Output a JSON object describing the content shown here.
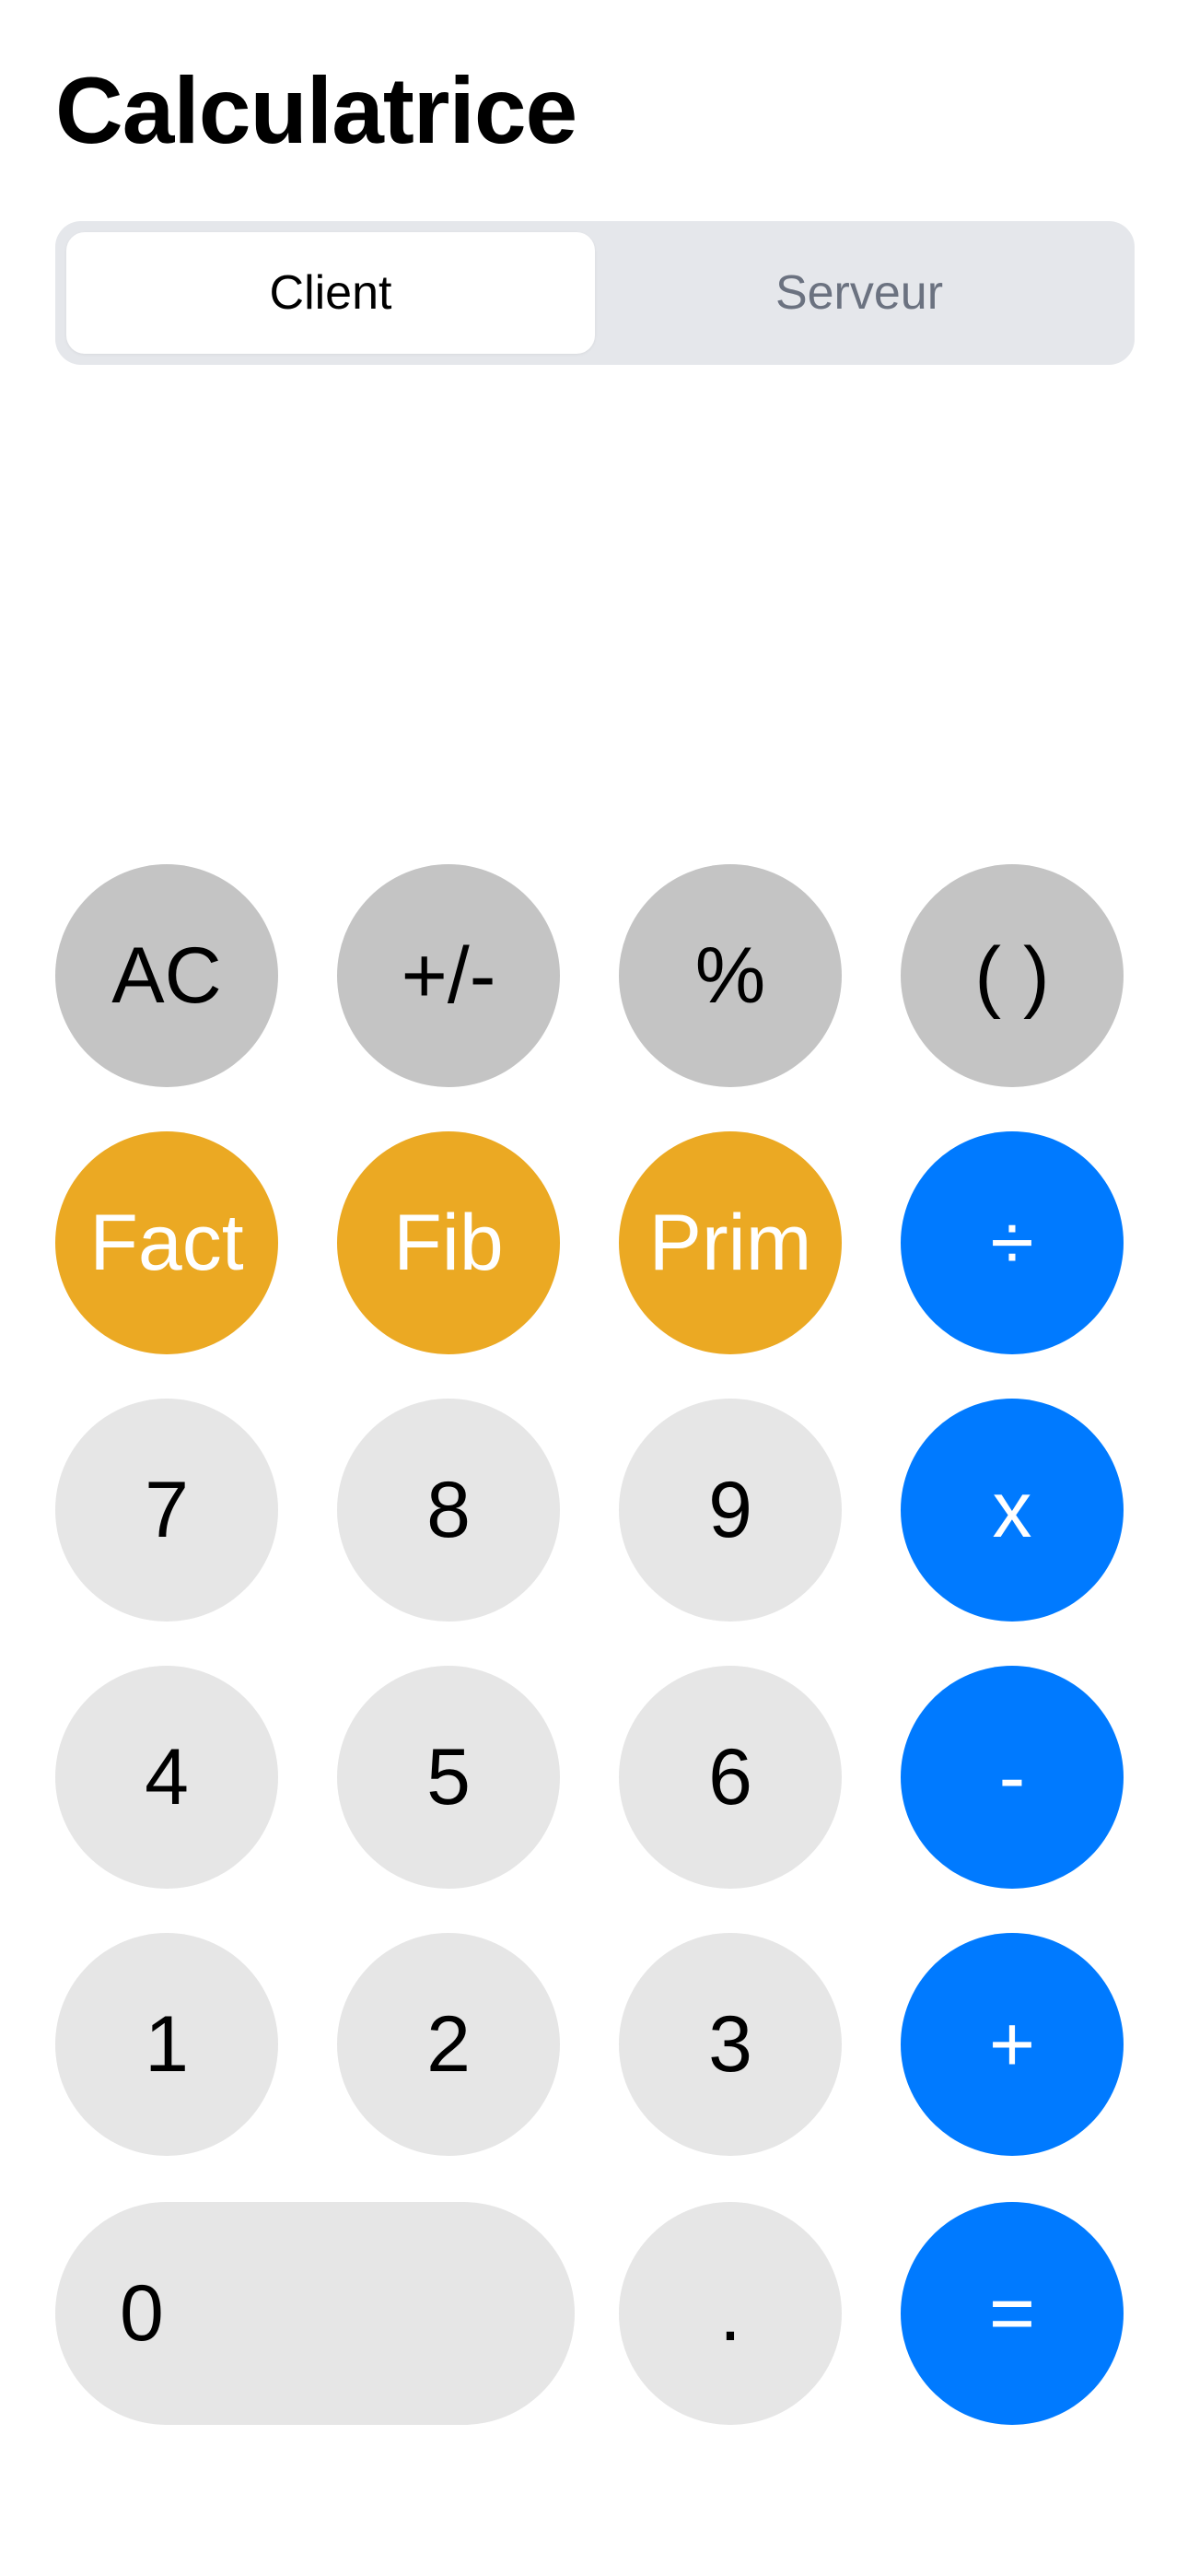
{
  "app": {
    "title": "Calculatrice"
  },
  "mode_switch": {
    "options": [
      {
        "label": "Client",
        "selected": true
      },
      {
        "label": "Serveur",
        "selected": false
      }
    ]
  },
  "display": {
    "value": ""
  },
  "keypad": {
    "row1": [
      "AC",
      "+/-",
      "%",
      "( )"
    ],
    "row2": [
      "Fact",
      "Fib",
      "Prim",
      "÷"
    ],
    "row3": [
      "7",
      "8",
      "9",
      "x"
    ],
    "row4": [
      "4",
      "5",
      "6",
      "-"
    ],
    "row5": [
      "1",
      "2",
      "3",
      "+"
    ],
    "row6": [
      "0",
      ".",
      "="
    ]
  },
  "colors": {
    "utility_key": "#c4c4c4",
    "function_key": "#eba923",
    "operator_key": "#007aff",
    "number_key": "#e6e6e6"
  }
}
